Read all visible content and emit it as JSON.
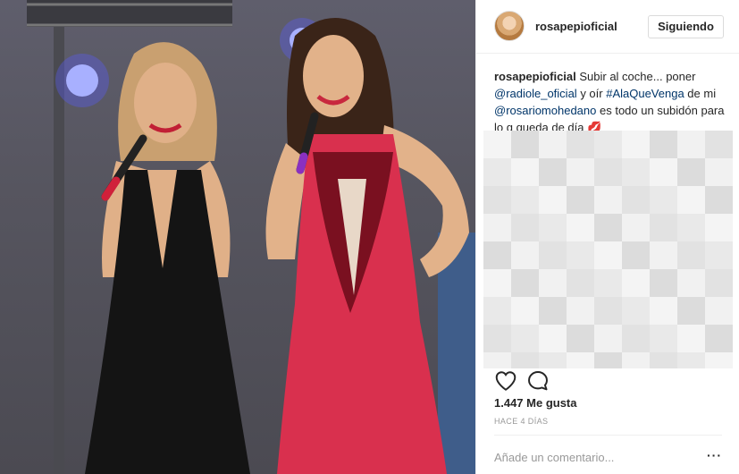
{
  "post": {
    "photo_alt": "Two women singing on stage",
    "author": "rosapepioficial",
    "follow_button": "Siguiendo",
    "caption": {
      "user": "rosapepioficial",
      "text_1": " Subir al coche... poner ",
      "mention_1": "@radiole_oficial",
      "text_2": " y oír ",
      "hashtag": "#AlaQueVenga",
      "text_3": " de mi ",
      "mention_2": "@rosariomohedano",
      "text_4": " es todo un subidón para lo q queda de día 💋"
    },
    "likes": "1.447 Me gusta",
    "timestamp": "HACE 4 DÍAS",
    "comment_placeholder": "Añade un comentario...",
    "more_label": "···"
  },
  "icons": {
    "like": "heart-icon",
    "comment": "comment-bubble-icon",
    "options": "more-options-icon"
  },
  "colors": {
    "link": "#003569",
    "border": "#efefef",
    "muted": "#999999"
  }
}
